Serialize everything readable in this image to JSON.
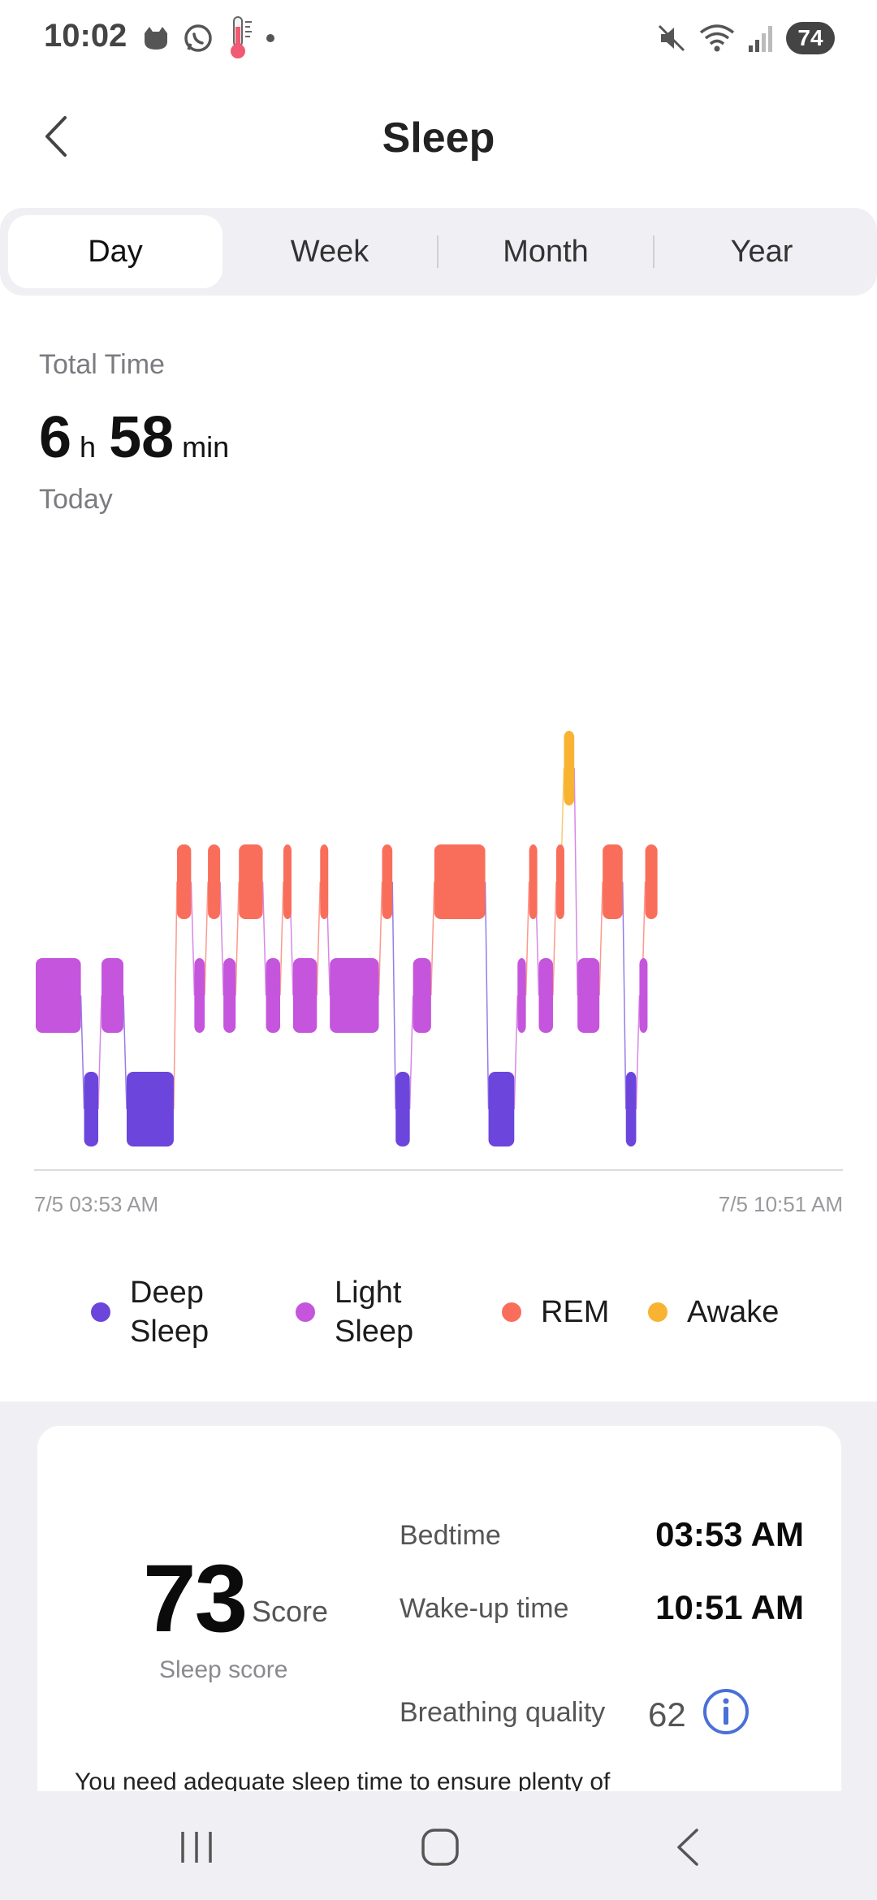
{
  "status": {
    "time": "10:02",
    "battery": "74"
  },
  "header": {
    "title": "Sleep"
  },
  "tabs": [
    {
      "label": "Day",
      "active": true
    },
    {
      "label": "Week",
      "active": false
    },
    {
      "label": "Month",
      "active": false
    },
    {
      "label": "Year",
      "active": false
    }
  ],
  "summary": {
    "total_label": "Total Time",
    "hours": "6",
    "hours_unit": "h",
    "minutes": "58",
    "minutes_unit": "min",
    "period_label": "Today"
  },
  "chart_data": {
    "type": "timeline",
    "start_label": "7/5 03:53 AM",
    "end_label": "7/5 10:51 AM",
    "stages": [
      "Awake",
      "REM",
      "Light Sleep",
      "Deep Sleep"
    ],
    "colors": {
      "Deep Sleep": "#6b45dc",
      "Light Sleep": "#c455dc",
      "REM": "#f96e5b",
      "Awake": "#f7b331"
    },
    "segments": [
      {
        "stage": "Light Sleep",
        "start": "03:53",
        "end": "04:18"
      },
      {
        "stage": "Deep Sleep",
        "start": "04:18",
        "end": "04:27"
      },
      {
        "stage": "Light Sleep",
        "start": "04:27",
        "end": "04:40"
      },
      {
        "stage": "Deep Sleep",
        "start": "04:40",
        "end": "05:06"
      },
      {
        "stage": "REM",
        "start": "05:06",
        "end": "05:15"
      },
      {
        "stage": "Light Sleep",
        "start": "05:15",
        "end": "05:22"
      },
      {
        "stage": "REM",
        "start": "05:22",
        "end": "05:30"
      },
      {
        "stage": "Light Sleep",
        "start": "05:30",
        "end": "05:38"
      },
      {
        "stage": "REM",
        "start": "05:38",
        "end": "05:52"
      },
      {
        "stage": "Light Sleep",
        "start": "05:52",
        "end": "06:01"
      },
      {
        "stage": "REM",
        "start": "06:01",
        "end": "06:06"
      },
      {
        "stage": "Light Sleep",
        "start": "06:06",
        "end": "06:20"
      },
      {
        "stage": "REM",
        "start": "06:20",
        "end": "06:25"
      },
      {
        "stage": "Light Sleep",
        "start": "06:25",
        "end": "06:52"
      },
      {
        "stage": "REM",
        "start": "06:52",
        "end": "06:59"
      },
      {
        "stage": "Deep Sleep",
        "start": "06:59",
        "end": "07:08"
      },
      {
        "stage": "Light Sleep",
        "start": "07:08",
        "end": "07:19"
      },
      {
        "stage": "REM",
        "start": "07:19",
        "end": "07:47"
      },
      {
        "stage": "Deep Sleep",
        "start": "07:47",
        "end": "08:02"
      },
      {
        "stage": "Light Sleep",
        "start": "08:02",
        "end": "08:08"
      },
      {
        "stage": "REM",
        "start": "08:08",
        "end": "08:13"
      },
      {
        "stage": "Light Sleep",
        "start": "08:13",
        "end": "08:22"
      },
      {
        "stage": "REM",
        "start": "08:22",
        "end": "08:26"
      },
      {
        "stage": "Awake",
        "start": "08:26",
        "end": "08:33"
      },
      {
        "stage": "Light Sleep",
        "start": "08:33",
        "end": "08:46"
      },
      {
        "stage": "REM",
        "start": "08:46",
        "end": "08:58"
      },
      {
        "stage": "Deep Sleep",
        "start": "08:58",
        "end": "09:05"
      },
      {
        "stage": "Light Sleep",
        "start": "09:05",
        "end": "09:08"
      },
      {
        "stage": "REM",
        "start": "09:08",
        "end": "09:16"
      }
    ]
  },
  "legend": [
    {
      "label": "Deep Sleep",
      "color": "#6b45dc"
    },
    {
      "label": "Light Sleep",
      "color": "#c455dc"
    },
    {
      "label": "REM",
      "color": "#f96e5b"
    },
    {
      "label": "Awake",
      "color": "#f7b331"
    }
  ],
  "score": {
    "value": "73",
    "unit": "Score",
    "label": "Sleep score",
    "bedtime_label": "Bedtime",
    "bedtime_value": "03:53 AM",
    "wake_label": "Wake-up time",
    "wake_value": "10:51 AM",
    "breathing_label": "Breathing quality",
    "breathing_value": "62",
    "advice": "You need adequate sleep time to ensure plenty of"
  }
}
